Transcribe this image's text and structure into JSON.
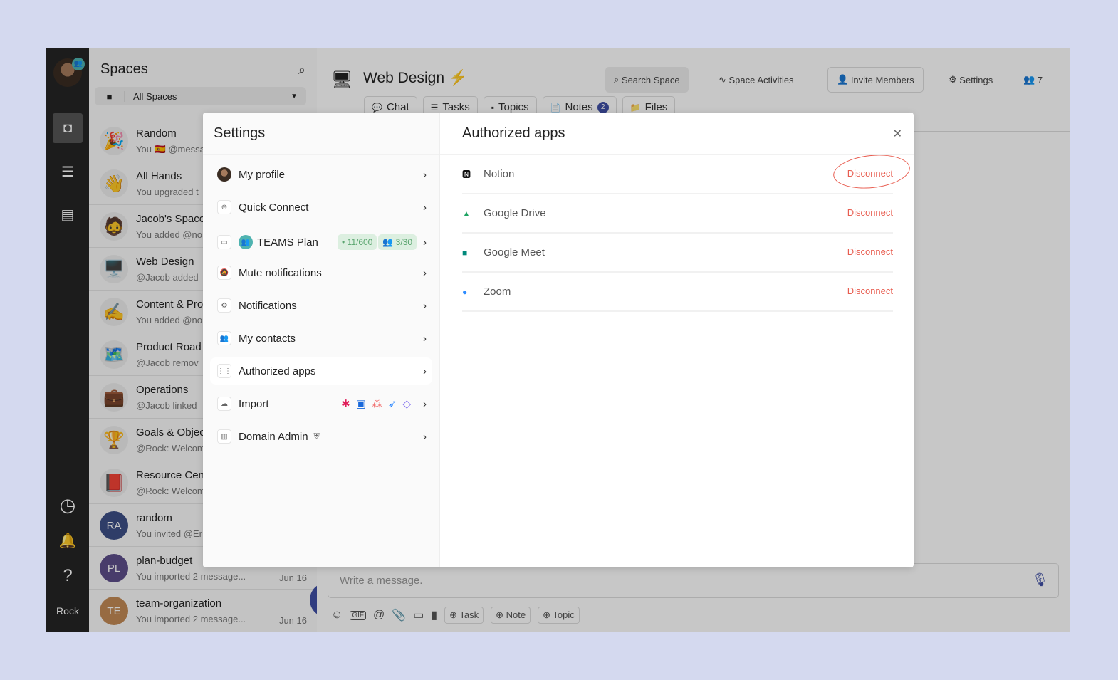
{
  "rail": {
    "user_label": "Rock"
  },
  "spaces": {
    "title": "Spaces",
    "filter": "All Spaces",
    "items": [
      {
        "name": "Random",
        "sub": "You 🇪🇸 @messa",
        "emoji": "🎉"
      },
      {
        "name": "All Hands",
        "sub": "You upgraded t",
        "emoji": "👋"
      },
      {
        "name": "Jacob's Space",
        "sub": "You added @no",
        "emoji": "🧔"
      },
      {
        "name": "Web Design",
        "sub": "@Jacob added",
        "emoji": "🖥️"
      },
      {
        "name": "Content & Pro",
        "sub": "You added @no",
        "emoji": "✍️"
      },
      {
        "name": "Product Road",
        "sub": "@Jacob remov",
        "emoji": "🗺️"
      },
      {
        "name": "Operations",
        "sub": "@Jacob linked",
        "emoji": "💼"
      },
      {
        "name": "Goals & Objec",
        "sub": "@Rock: Welcom",
        "emoji": "🏆"
      },
      {
        "name": "Resource Cen",
        "sub": "@Rock: Welcom",
        "emoji": "📕"
      },
      {
        "name": "random",
        "sub": "You invited @Er",
        "initials": "RA",
        "color": "#3d4f86"
      },
      {
        "name": "plan-budget",
        "sub": "You imported 2 message...",
        "initials": "PL",
        "color": "#5d4d8a",
        "date": "Jun 16"
      },
      {
        "name": "team-organization",
        "sub": "You imported 2 message...",
        "initials": "TE",
        "color": "#c28a55",
        "date": "Jun 16"
      }
    ]
  },
  "header": {
    "title": "Web Design",
    "search": "Search Space",
    "activities": "Space Activities",
    "invite": "Invite Members",
    "settings": "Settings",
    "members": "7",
    "tabs": [
      {
        "label": "Chat",
        "icon": "💬"
      },
      {
        "label": "Tasks",
        "icon": "☰"
      },
      {
        "label": "Topics",
        "icon": "▪"
      },
      {
        "label": "Notes",
        "icon": "📄",
        "badge": "2"
      },
      {
        "label": "Files",
        "icon": "📁"
      }
    ]
  },
  "composer": {
    "placeholder": "Write a message.",
    "task": "Task",
    "note": "Note",
    "topic": "Topic"
  },
  "settings": {
    "title": "Settings",
    "items": [
      {
        "label": "My profile"
      },
      {
        "label": "Quick Connect"
      },
      {
        "label": "TEAMS Plan",
        "pill1": "11/600",
        "pill2": "3/30"
      },
      {
        "label": "Mute notifications"
      },
      {
        "label": "Notifications"
      },
      {
        "label": "My contacts"
      },
      {
        "label": "Authorized apps"
      },
      {
        "label": "Import"
      },
      {
        "label": "Domain Admin"
      }
    ]
  },
  "authorized": {
    "title": "Authorized apps",
    "action": "Disconnect",
    "apps": [
      {
        "name": "Notion"
      },
      {
        "name": "Google Drive"
      },
      {
        "name": "Google Meet"
      },
      {
        "name": "Zoom"
      }
    ]
  },
  "colors": {
    "accent": "#3f4fa5",
    "danger": "#e85d50",
    "teal": "#4fb3b0"
  }
}
